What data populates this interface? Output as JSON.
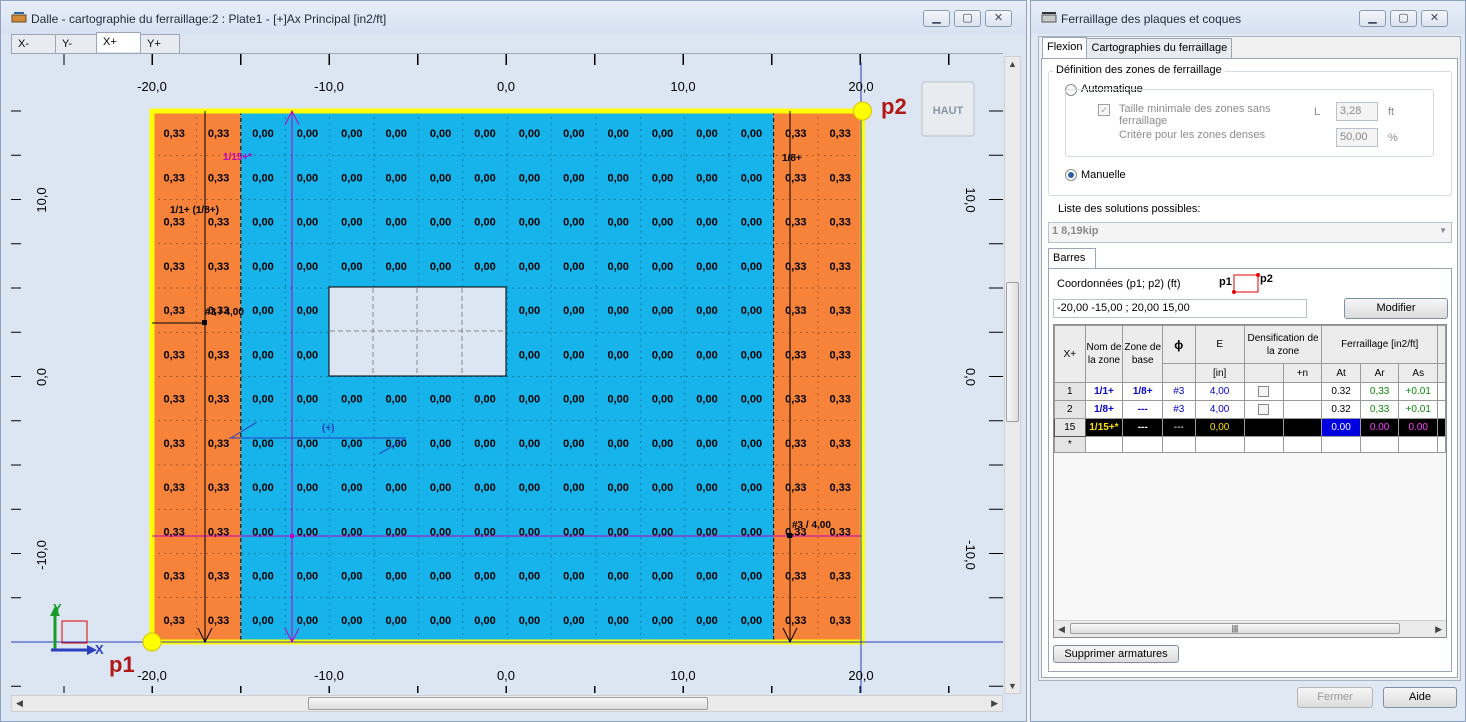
{
  "left_window": {
    "title": "Dalle - cartographie du ferraillage:2 : Plate1 - [+]Ax Principal [in2/ft]",
    "view_tabs": [
      "X-",
      "Y-",
      "X+",
      "Y+"
    ],
    "active_view_tab": "X+",
    "view_cube_label": "HAUT",
    "point_labels": {
      "p1": "p1",
      "p2": "p2"
    },
    "axis_labels": {
      "x": "X",
      "y": "Y"
    },
    "top_axis_ticks": [
      "-20,0",
      "-10,0",
      "0,0",
      "10,0",
      "20,0"
    ],
    "bottom_axis_ticks": [
      "-20,0",
      "-10,0",
      "0,0",
      "10,0",
      "20,0"
    ],
    "left_axis_ticks": [
      "10,0",
      "0,0",
      "-10,0"
    ],
    "right_axis_ticks": [
      "10,0",
      "0,0",
      "-10,0"
    ],
    "cell_values": {
      "edge": "0,33",
      "center": "0,00"
    },
    "annotations": {
      "zone_left": "1/1+ (1/8+)",
      "zone_right": "1/8+",
      "zone_magenta": "1/15+*",
      "bar_left": "#3 / 4,00",
      "bar_right": "#3 / 4,00",
      "plus_marker": "(+)"
    },
    "colors": {
      "edge_zone": "#f7823a",
      "center_zone": "#16b4ea",
      "border": "#ffff00",
      "opening": "#dce6f2"
    }
  },
  "right_window": {
    "title": "Ferraillage des plaques et coques",
    "tabs": [
      "Flexion",
      "Cartographies du ferraillage"
    ],
    "active_tab": "Flexion",
    "zone_definition": {
      "legend": "Définition des zones de ferraillage",
      "automatic_label": "Automatique",
      "min_size_label": "Taille minimale des zones sans ferraillage",
      "min_size_letter": "L",
      "min_size_value": "3,28",
      "min_size_unit": "ft",
      "dense_label": "Critère pour les zones denses",
      "dense_value": "50,00",
      "dense_unit": "%",
      "manual_label": "Manuelle",
      "selected": "Manuelle"
    },
    "solutions_label": "Liste des solutions possibles:",
    "solution_selected": "1    8,19kip",
    "bars_tab": "Barres",
    "coords_label": "Coordonnées (p1; p2) (ft)",
    "coords_p1": "p1",
    "coords_p2": "p2",
    "coords_value": "-20,00  -15,00  ;  20,00  15,00",
    "modify_button": "Modifier",
    "table": {
      "corner": "X+",
      "headers": {
        "zone_name": "Nom de la zone",
        "base_zone": "Zone de base",
        "phi": "ϕ",
        "e": "E",
        "densification": "Densification de la zone",
        "reinforcement": "Ferraillage [in2/ft]",
        "e_unit": "[in]",
        "plus_n": "+n",
        "at": "At",
        "ar": "Ar",
        "as": "As"
      },
      "rows": [
        {
          "id": "1",
          "zone": "1/1+",
          "base": "1/8+",
          "phi": "#3",
          "e": "4,00",
          "at": "0.32",
          "ar": "0,33",
          "as": "+0.01"
        },
        {
          "id": "2",
          "zone": "1/8+",
          "base": "---",
          "phi": "#3",
          "e": "4,00",
          "at": "0.32",
          "ar": "0,33",
          "as": "+0.01"
        },
        {
          "id": "15",
          "zone": "1/15+*",
          "base": "---",
          "phi": "---",
          "e": "0,00",
          "at": "0.00",
          "ar": "0.00",
          "as": "0.00"
        }
      ],
      "new_row_marker": "*"
    },
    "delete_button": "Supprimer armatures",
    "close_button": "Fermer",
    "help_button": "Aide"
  }
}
